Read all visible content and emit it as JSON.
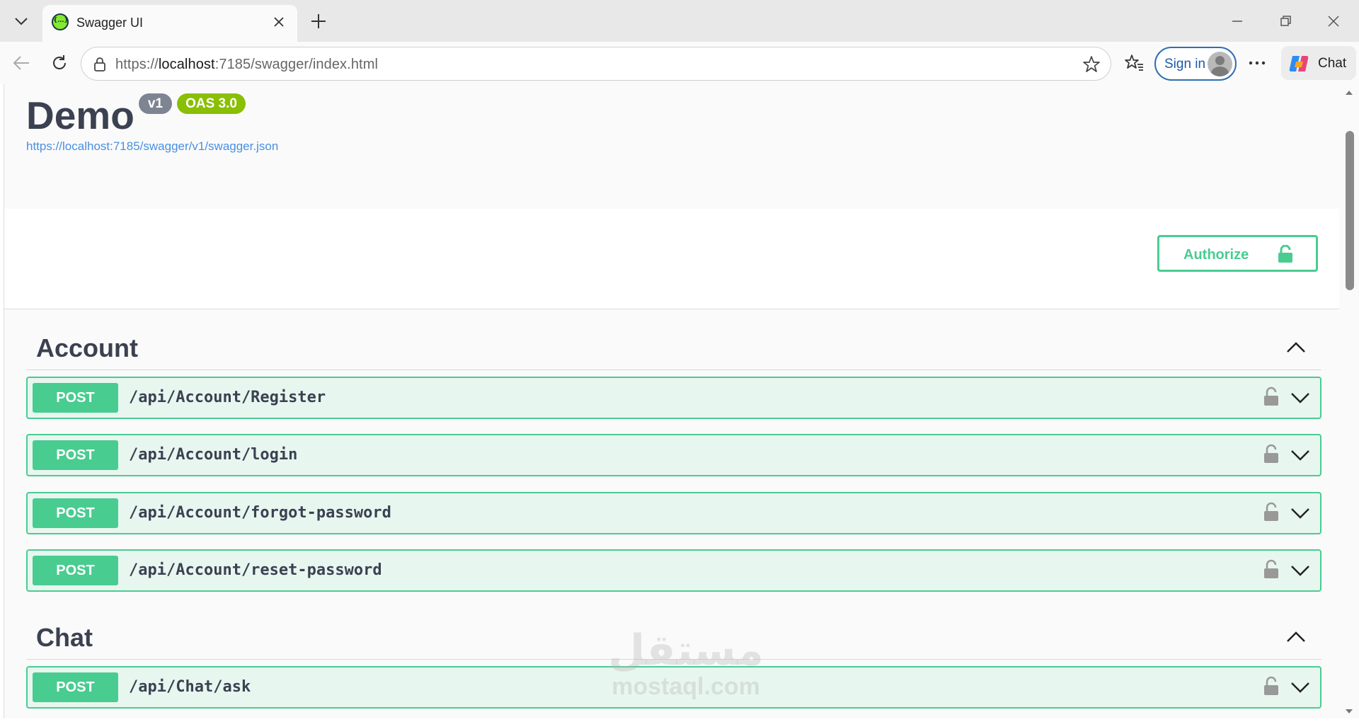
{
  "browser": {
    "tab_title": "Swagger UI",
    "url_scheme": "https://",
    "url_host": "localhost",
    "url_rest": ":7185/swagger/index.html",
    "sign_in_label": "Sign in",
    "chat_label": "Chat"
  },
  "info": {
    "title": "Demo",
    "version": "v1",
    "oas_version": "OAS 3.0",
    "spec_url": "https://localhost:7185/swagger/v1/swagger.json"
  },
  "authorize_label": "Authorize",
  "tags": [
    {
      "name": "Account",
      "operations": [
        {
          "method": "POST",
          "path": "/api/Account/Register"
        },
        {
          "method": "POST",
          "path": "/api/Account/login"
        },
        {
          "method": "POST",
          "path": "/api/Account/forgot-password"
        },
        {
          "method": "POST",
          "path": "/api/Account/reset-password"
        }
      ]
    },
    {
      "name": "Chat",
      "operations": [
        {
          "method": "POST",
          "path": "/api/Chat/ask"
        }
      ]
    }
  ],
  "watermark": {
    "arabic": "مستقل",
    "latin": "mostaql.com"
  },
  "colors": {
    "post_green": "#49cc90",
    "post_bg": "#e8f6f0",
    "title_text": "#3b4151",
    "oas_badge": "#89bf04",
    "version_badge": "#7d8492",
    "link": "#4990e2"
  }
}
